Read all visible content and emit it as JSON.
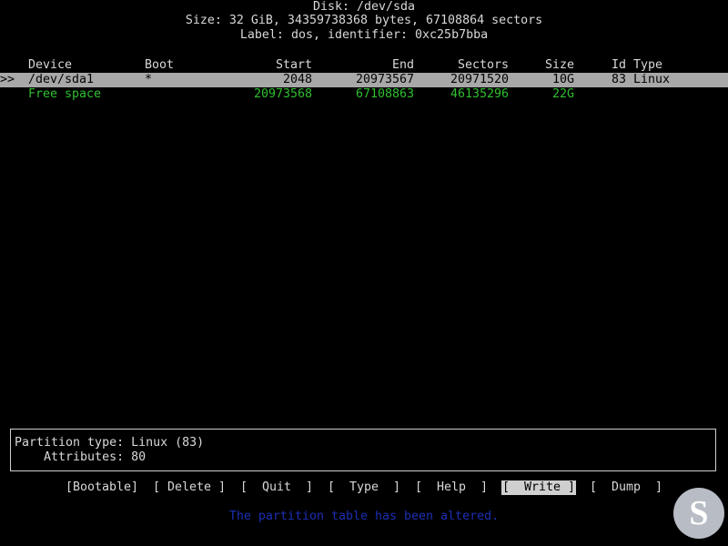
{
  "header": {
    "disk_title": "Disk: /dev/sda",
    "size_line": "Size: 32 GiB, 34359738368 bytes, 67108864 sectors",
    "label_line": "Label: dos, identifier: 0xc25b7bba"
  },
  "columns": {
    "device": "Device",
    "boot": "Boot",
    "start": "Start",
    "end": "End",
    "sectors": "Sectors",
    "size": "Size",
    "id": "Id",
    "type": "Type"
  },
  "rows": [
    {
      "cursor": ">>",
      "device": "/dev/sda1",
      "boot": "*",
      "start": "2048",
      "end": "20973567",
      "sectors": "20971520",
      "size": "10G",
      "id": "83",
      "type": "Linux"
    },
    {
      "cursor": "",
      "device": "Free space",
      "boot": "",
      "start": "20973568",
      "end": "67108863",
      "sectors": "46135296",
      "size": "22G",
      "id": "",
      "type": ""
    }
  ],
  "info": {
    "partition_type": "Partition type: Linux (83)",
    "attributes": "    Attributes: 80"
  },
  "menu": [
    {
      "label": "[Bootable]",
      "active": false
    },
    {
      "label": "[ Delete ]",
      "active": false
    },
    {
      "label": "[  Quit  ]",
      "active": false
    },
    {
      "label": "[  Type  ]",
      "active": false
    },
    {
      "label": "[  Help  ]",
      "active": false
    },
    {
      "label": "[  Write ]",
      "active": true
    },
    {
      "label": "[  Dump  ]",
      "active": false
    }
  ],
  "status_message": "The partition table has been altered.",
  "watermark_letter": "S",
  "colors": {
    "background": "#000000",
    "text": "#d8d8d8",
    "selected_row_bg": "#a8a8a8",
    "free_space": "#2fbf2f",
    "status_message": "#1c2fb4"
  }
}
